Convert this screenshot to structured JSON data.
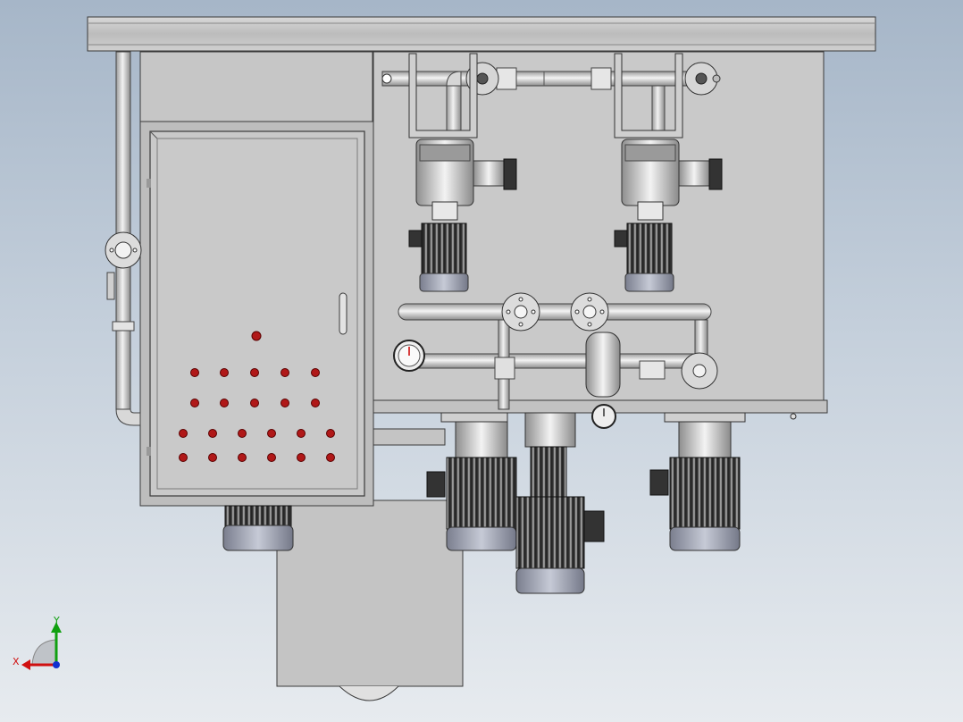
{
  "viewport": {
    "background_top": "#a6b6c8",
    "background_bottom": "#e7ebef"
  },
  "colors": {
    "sheet_metal": "#c8c8c8",
    "sheet_metal_dark": "#b9b9b9",
    "outline": "#3a3a3a",
    "pipe": "#d9d9d9",
    "motor_body": "#2b2b2b",
    "motor_cap": "#a0a4b4",
    "indicator_light": "#b01818"
  },
  "panel": {
    "indicator_rows": [
      1,
      5,
      5,
      6,
      6
    ]
  },
  "components": {
    "pump_heads": [
      "pump-head-left",
      "pump-head-right"
    ],
    "lower_motors": [
      "motor-panel-bottom",
      "motor-center-left",
      "motor-center-vertical",
      "motor-right"
    ],
    "flanges": [
      "flange-top-left",
      "flange-top-right",
      "flange-mid-left",
      "flange-mid-right",
      "flange-side-left"
    ],
    "gauges": [
      "pressure-gauge-left",
      "pressure-gauge-bottom"
    ]
  },
  "triad": {
    "x_label": "X",
    "y_label": "Y",
    "x_color": "#d01010",
    "y_color": "#10a010",
    "z_color": "#1030d0"
  }
}
